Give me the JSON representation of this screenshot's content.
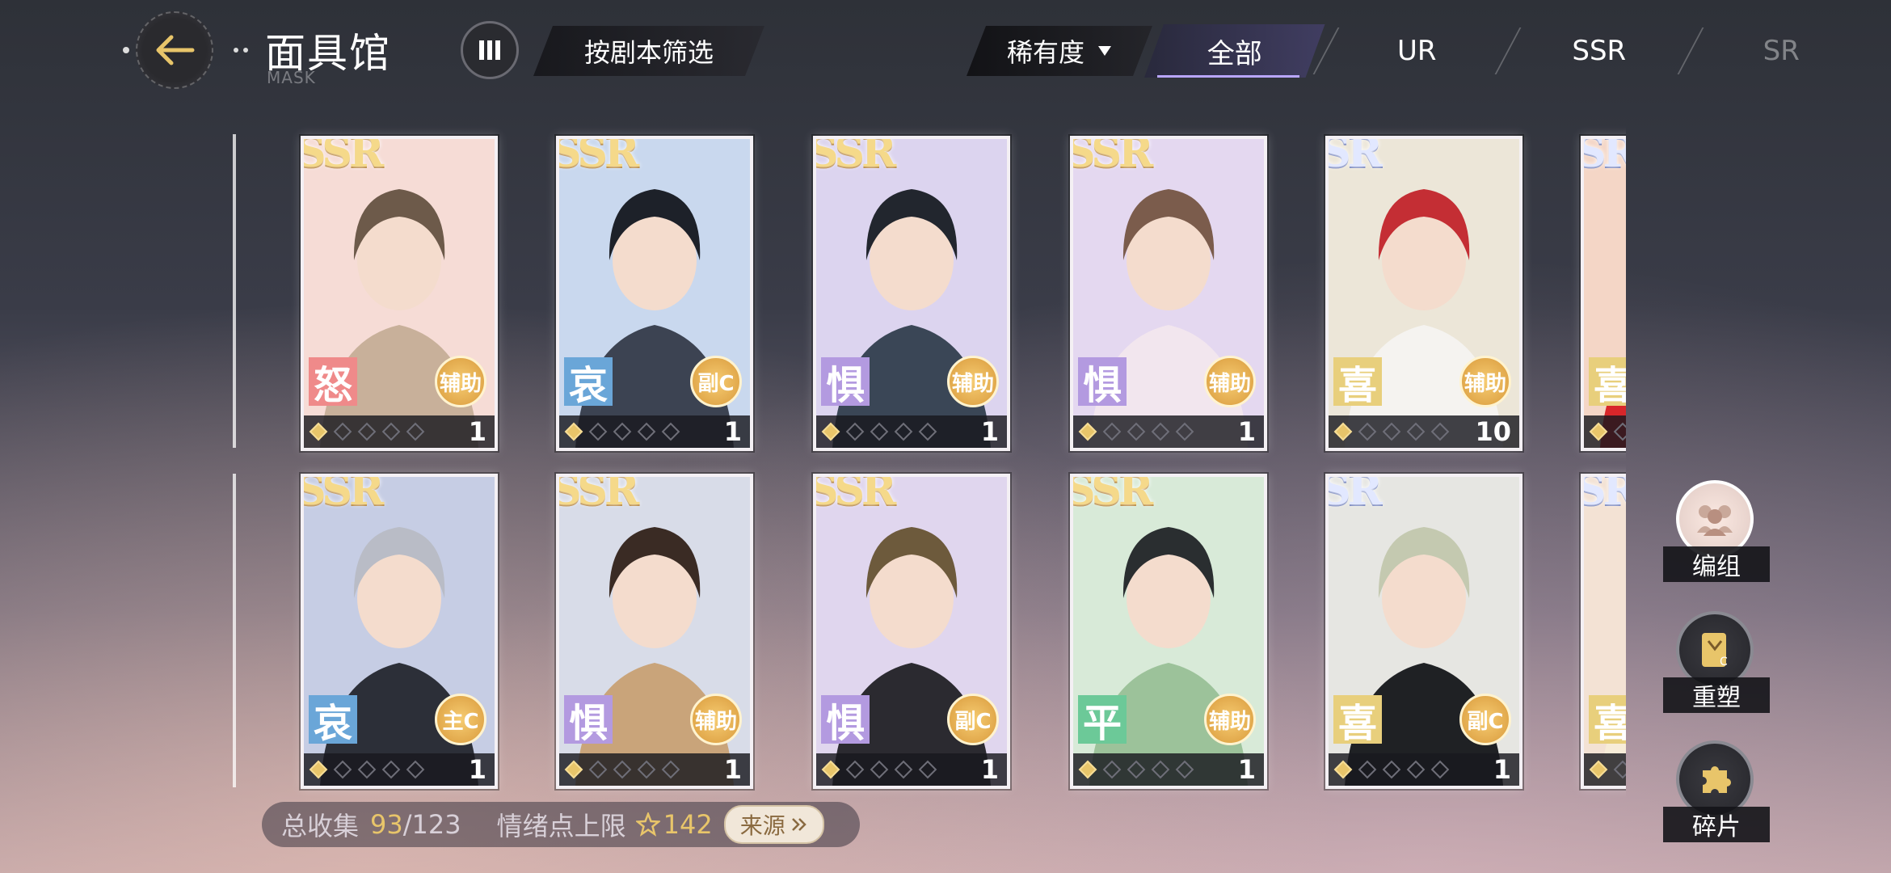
{
  "header": {
    "title": "面具馆",
    "subtitle": "MASK",
    "filter_label": "按剧本筛选",
    "rarity_label": "稀有度",
    "tabs": [
      "全部",
      "UR",
      "SSR",
      "SR"
    ],
    "active_tab": "全部"
  },
  "cards": [
    {
      "rarity": "SSR",
      "emotion": "怒",
      "emotion_key": "anger",
      "role": "辅助",
      "stars": 1,
      "count": "1",
      "palette": [
        "#f6dcd6",
        "#c8b09a",
        "#6d5a4a"
      ]
    },
    {
      "rarity": "SSR",
      "emotion": "哀",
      "emotion_key": "sad",
      "role": "副C",
      "stars": 1,
      "count": "1",
      "palette": [
        "#c9d8ee",
        "#3c4352",
        "#1d2129"
      ]
    },
    {
      "rarity": "SSR",
      "emotion": "惧",
      "emotion_key": "fear",
      "role": "辅助",
      "stars": 1,
      "count": "1",
      "palette": [
        "#dcd4ef",
        "#3a4656",
        "#22262e"
      ]
    },
    {
      "rarity": "SSR",
      "emotion": "惧",
      "emotion_key": "fear",
      "role": "辅助",
      "stars": 1,
      "count": "1",
      "palette": [
        "#e4d8f0",
        "#f2e6ee",
        "#7b5c4c"
      ]
    },
    {
      "rarity": "SR",
      "emotion": "喜",
      "emotion_key": "joy",
      "role": "辅助",
      "stars": 1,
      "count": "10",
      "palette": [
        "#ece6d8",
        "#f5f3f0",
        "#c42e34"
      ]
    },
    {
      "rarity": "SR",
      "emotion": "喜",
      "emotion_key": "joy",
      "role": "",
      "stars": 1,
      "count": "",
      "palette": [
        "#f4d6c6",
        "#d8262a",
        "#e9c64a"
      ]
    },
    {
      "rarity": "SSR",
      "emotion": "哀",
      "emotion_key": "sad",
      "role": "主C",
      "stars": 1,
      "count": "1",
      "palette": [
        "#c6cde4",
        "#2c2f38",
        "#b9bcc6"
      ]
    },
    {
      "rarity": "SSR",
      "emotion": "惧",
      "emotion_key": "fear",
      "role": "辅助",
      "stars": 1,
      "count": "1",
      "palette": [
        "#d8dce8",
        "#c9a47a",
        "#3a2b24"
      ]
    },
    {
      "rarity": "SSR",
      "emotion": "惧",
      "emotion_key": "fear",
      "role": "副C",
      "stars": 1,
      "count": "1",
      "palette": [
        "#e0d6ee",
        "#2b2a30",
        "#6d5a3c"
      ]
    },
    {
      "rarity": "SSR",
      "emotion": "平",
      "emotion_key": "calm",
      "role": "辅助",
      "stars": 1,
      "count": "1",
      "palette": [
        "#d8ead8",
        "#9cc29a",
        "#2a2e30"
      ]
    },
    {
      "rarity": "SR",
      "emotion": "喜",
      "emotion_key": "joy",
      "role": "副C",
      "stars": 1,
      "count": "1",
      "palette": [
        "#e6e6e2",
        "#1f2124",
        "#c4c9b0"
      ]
    },
    {
      "rarity": "SR",
      "emotion": "喜",
      "emotion_key": "joy",
      "role": "",
      "stars": 1,
      "count": "",
      "palette": [
        "#f3e2d4",
        "#f7ecd8",
        "#d8b07a"
      ]
    }
  ],
  "side_buttons": [
    {
      "label": "编组",
      "icon": "group-icon"
    },
    {
      "label": "重塑",
      "icon": "reshape-card-icon"
    },
    {
      "label": "碎片",
      "icon": "puzzle-icon"
    }
  ],
  "status": {
    "collect_label": "总收集",
    "collected": "93",
    "total": "/123",
    "emotion_cap_label": "情绪点上限",
    "emotion_cap_value": "142",
    "source_label": "来源"
  }
}
